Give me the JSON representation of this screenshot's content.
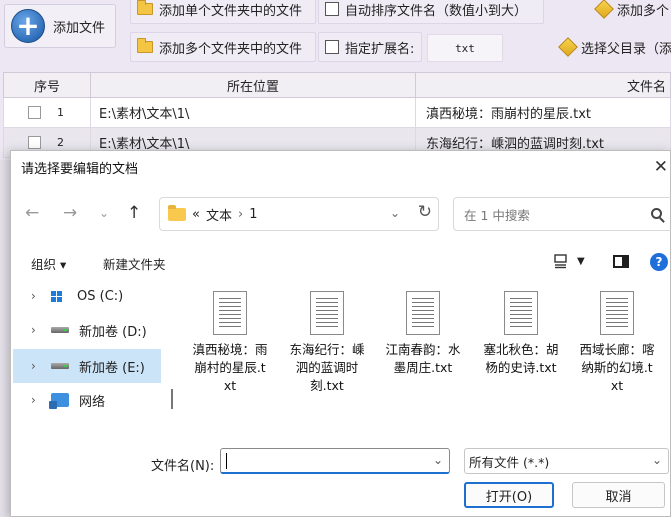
{
  "app": {
    "add_file_label": "添加文件",
    "buttons": {
      "add_single_folder": "添加单个文件夹中的文件",
      "add_multi_folder": "添加多个文件夹中的文件",
      "auto_sort": "自动排序文件名（数值小到大）",
      "specify_ext": "指定扩展名:",
      "ext_value": "txt",
      "add_multi_truncated": "添加多个",
      "choose_parent_truncated": "选择父目录（添"
    },
    "grid": {
      "headers": [
        "序号",
        "所在位置",
        "文件名"
      ],
      "rows": [
        {
          "index": "1",
          "location": "E:\\素材\\文本\\1\\",
          "filename": "滇西秘境：雨崩村的星辰.txt"
        },
        {
          "index": "2",
          "location": "E:\\素材\\文本\\1\\",
          "filename": "东海纪行：嵊泗的蓝调时刻.txt"
        }
      ]
    }
  },
  "dialog": {
    "title": "请选择要编辑的文档",
    "address": {
      "overflow": "«",
      "crumbs": [
        "文本",
        "1"
      ]
    },
    "search_placeholder": "在 1 中搜索",
    "commands": {
      "organize": "组织 ▾",
      "new_folder": "新建文件夹"
    },
    "tree": [
      {
        "label": "OS (C:)",
        "icon": "windows-drive-icon",
        "selected": false
      },
      {
        "label": "新加卷 (D:)",
        "icon": "drive-icon",
        "selected": false
      },
      {
        "label": "新加卷 (E:)",
        "icon": "drive-icon",
        "selected": true
      },
      {
        "label": "网络",
        "icon": "network-icon",
        "selected": false
      }
    ],
    "files": [
      {
        "name": "滇西秘境：雨崩村的星辰.txt"
      },
      {
        "name": "东海纪行：嵊泗的蓝调时刻.txt"
      },
      {
        "name": "江南春韵：水墨周庄.txt"
      },
      {
        "name": "塞北秋色：胡杨的史诗.txt"
      },
      {
        "name": "西域长廊：喀纳斯的幻境.txt"
      }
    ],
    "filename_label": "文件名(N):",
    "filename_value": "",
    "filetype_value": "所有文件 (*.*)",
    "open_label": "打开(O)",
    "cancel_label": "取消"
  }
}
